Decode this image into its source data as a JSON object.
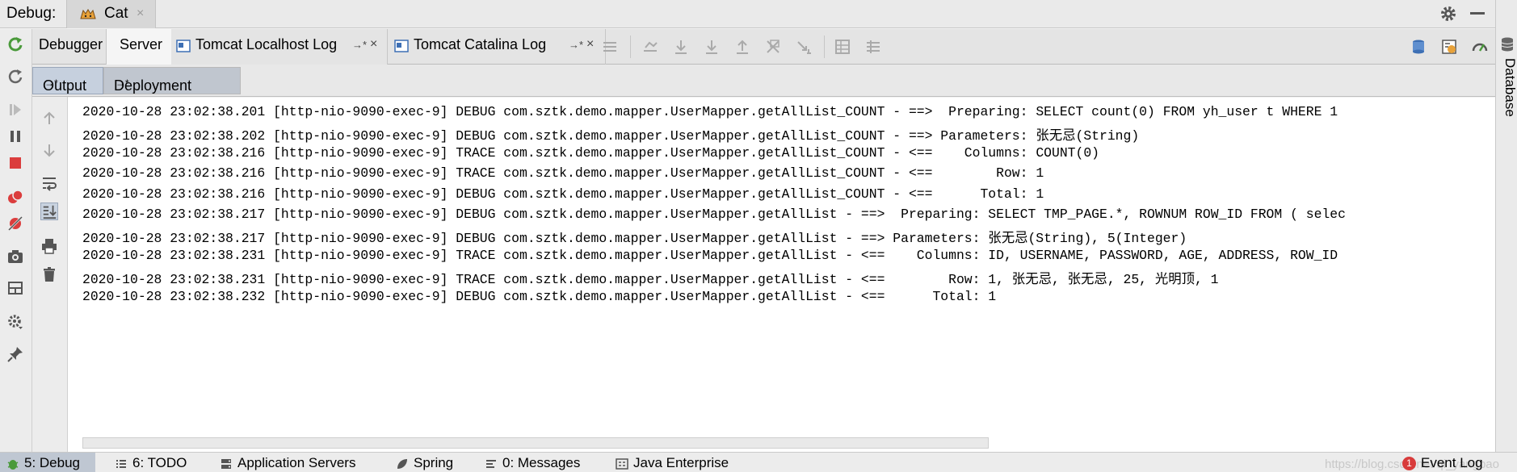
{
  "titlebar": {
    "label": "Debug:",
    "run_config_tab": "Cat",
    "close_glyph": "×"
  },
  "right_panel": {
    "database_label": "Database"
  },
  "toolbar": {
    "tabs": [
      {
        "label": "Debugger",
        "active": false
      },
      {
        "label": "Server",
        "active": true
      },
      {
        "label": "Tomcat Localhost Log",
        "pin": "→*",
        "close": "×"
      },
      {
        "label": "Tomcat Catalina Log",
        "pin": "→*",
        "close": "×"
      }
    ]
  },
  "subtabs": {
    "output": "Output",
    "output_pin": "→*",
    "deployment": "Deployment",
    "deployment_pin": "→*"
  },
  "console": {
    "lines": [
      "2020-10-28 23:02:38.201 [http-nio-9090-exec-9] DEBUG com.sztk.demo.mapper.UserMapper.getAllList_COUNT - ==>  Preparing: SELECT count(0) FROM yh_user t WHERE 1",
      "2020-10-28 23:02:38.202 [http-nio-9090-exec-9] DEBUG com.sztk.demo.mapper.UserMapper.getAllList_COUNT - ==> Parameters: 张无忌(String)",
      "2020-10-28 23:02:38.216 [http-nio-9090-exec-9] TRACE com.sztk.demo.mapper.UserMapper.getAllList_COUNT - <==    Columns: COUNT(0)",
      "2020-10-28 23:02:38.216 [http-nio-9090-exec-9] TRACE com.sztk.demo.mapper.UserMapper.getAllList_COUNT - <==        Row: 1",
      "2020-10-28 23:02:38.216 [http-nio-9090-exec-9] DEBUG com.sztk.demo.mapper.UserMapper.getAllList_COUNT - <==      Total: 1",
      "2020-10-28 23:02:38.217 [http-nio-9090-exec-9] DEBUG com.sztk.demo.mapper.UserMapper.getAllList - ==>  Preparing: SELECT TMP_PAGE.*, ROWNUM ROW_ID FROM ( selec",
      "2020-10-28 23:02:38.217 [http-nio-9090-exec-9] DEBUG com.sztk.demo.mapper.UserMapper.getAllList - ==> Parameters: 张无忌(String), 5(Integer)",
      "2020-10-28 23:02:38.231 [http-nio-9090-exec-9] TRACE com.sztk.demo.mapper.UserMapper.getAllList - <==    Columns: ID, USERNAME, PASSWORD, AGE, ADDRESS, ROW_ID",
      "2020-10-28 23:02:38.231 [http-nio-9090-exec-9] TRACE com.sztk.demo.mapper.UserMapper.getAllList - <==        Row: 1, 张无忌, 张无忌, 25, 光明顶, 1",
      "2020-10-28 23:02:38.232 [http-nio-9090-exec-9] DEBUG com.sztk.demo.mapper.UserMapper.getAllList - <==      Total: 1"
    ]
  },
  "statusbar": {
    "items": [
      {
        "label": "5: Debug",
        "icon": "bug-icon"
      },
      {
        "label": "6: TODO",
        "icon": "list-icon"
      },
      {
        "label": "Application Servers",
        "icon": "server-icon"
      },
      {
        "label": "Spring",
        "icon": "spring-leaf-icon"
      },
      {
        "label": "0: Messages",
        "icon": "messages-icon"
      },
      {
        "label": "Java Enterprise",
        "icon": "java-ee-icon"
      }
    ],
    "watermark": "https://blog.csdn.net/qi_yangbao",
    "event_log_badge": "1",
    "event_log": "Event Log"
  },
  "colors": {
    "run_green": "#4a9a3b",
    "stop_red": "#db3d3d",
    "icon_blue": "#3d6fb4",
    "active_subtab": "#c6d0de"
  }
}
